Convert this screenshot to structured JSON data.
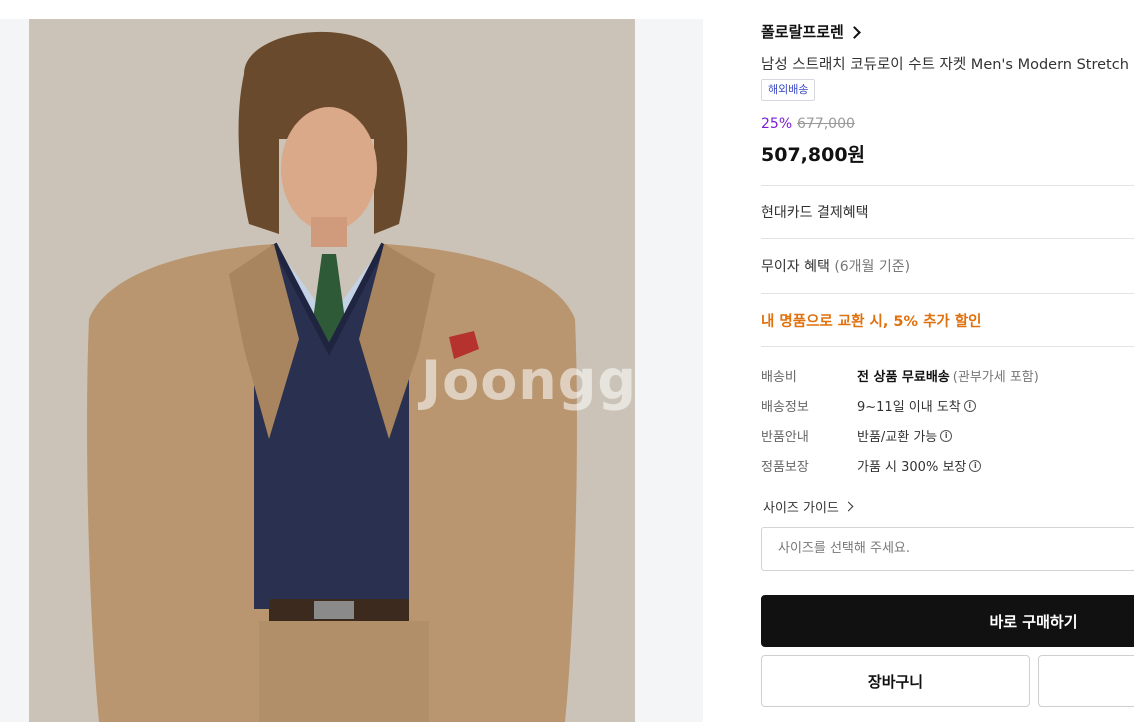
{
  "product": {
    "brand": "폴로랄프로렌",
    "title": "남성 스트래치 코듀로이 수트 자켓 Men's Modern Stretch",
    "badge": "해외배송",
    "discount": "25%",
    "original_price": "677,000",
    "price": "507,800원",
    "image_watermark": "Joonggonara"
  },
  "benefits": {
    "card": "현대카드 결제혜택",
    "installment": "무이자 혜택",
    "installment_note": "(6개월 기준)",
    "promo": "내 명품으로 교환 시, 5% 추가 할인"
  },
  "specs": [
    {
      "label": "배송비",
      "value": "전 상품 무료배송",
      "note": "(관부가세 포함)",
      "info": false
    },
    {
      "label": "배송정보",
      "value": "9~11일 이내 도착",
      "note": "",
      "info": true
    },
    {
      "label": "반품안내",
      "value": "반품/교환 가능",
      "note": "",
      "info": true
    },
    {
      "label": "정품보장",
      "value": "가품 시 300% 보장",
      "note": "",
      "info": true
    }
  ],
  "size": {
    "guide_label": "사이즈 가이드",
    "placeholder": "사이즈를 선택해 주세요."
  },
  "actions": {
    "buy_now": "바로 구매하기",
    "cart": "장바구니"
  },
  "colors": {
    "discount": "#7b1fd6",
    "promo": "#e0710f",
    "badge_text": "#3a49c4",
    "primary_button": "#111111"
  }
}
